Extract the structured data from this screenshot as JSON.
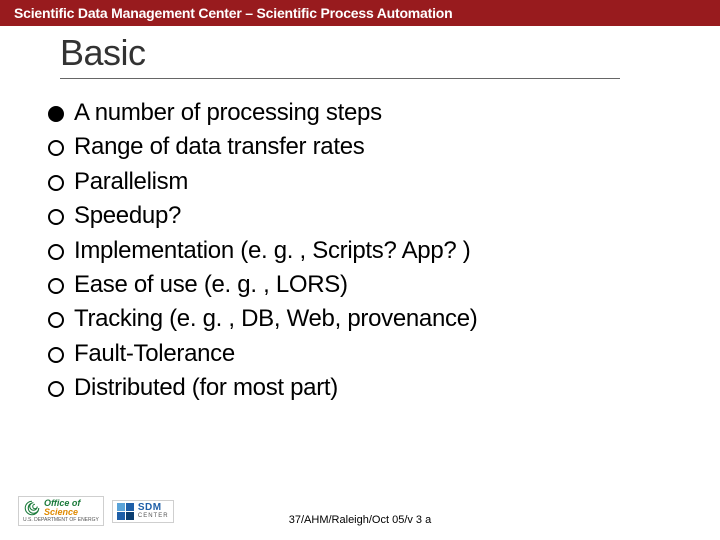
{
  "header": {
    "text": "Scientific Data Management Center – Scientific Process Automation"
  },
  "title": "Basic",
  "bullets": [
    {
      "filled": true,
      "text": "A number of processing steps"
    },
    {
      "filled": false,
      "text": "Range of data transfer rates"
    },
    {
      "filled": false,
      "text": "Parallelism"
    },
    {
      "filled": false,
      "text": "Speedup?"
    },
    {
      "filled": false,
      "text": "Implementation (e. g. , Scripts? App? )"
    },
    {
      "filled": false,
      "text": "Ease of use (e. g. , LORS)"
    },
    {
      "filled": false,
      "text": "Tracking (e. g. , DB, Web, provenance)"
    },
    {
      "filled": false,
      "text": "Fault-Tolerance"
    },
    {
      "filled": false,
      "text": "Distributed (for most part)"
    }
  ],
  "logos": {
    "office_of_science": {
      "line1": "Office of",
      "line2": "Science",
      "sub": "U.S. DEPARTMENT OF ENERGY"
    },
    "sdm": {
      "main": "SDM",
      "sub": "CENTER"
    }
  },
  "footer": "37/AHM/Raleigh/Oct 05/v 3 a"
}
